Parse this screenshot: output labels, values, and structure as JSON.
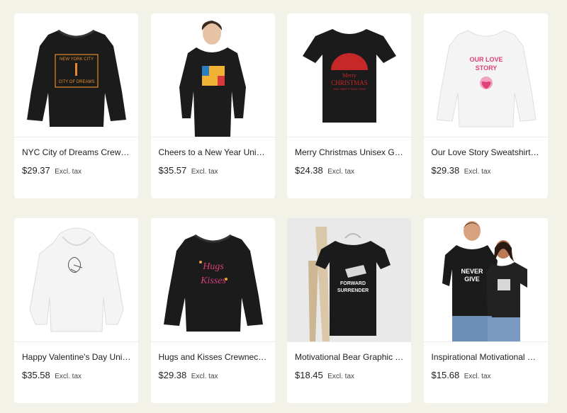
{
  "products": [
    {
      "title": "NYC City of Dreams Crewneck Sweatshirt",
      "price": "$29.37",
      "tax_note": "Excl. tax",
      "image_icon": "black-sweatshirt-nyc-print",
      "banner_top": "NEW YORK CITY",
      "banner_bottom": "CITY OF DREAMS"
    },
    {
      "title": "Cheers to a New Year Unisex Hoodie",
      "price": "$35.57",
      "tax_note": "Excl. tax",
      "image_icon": "woman-black-hoodie-cheers-print"
    },
    {
      "title": "Merry Christmas Unisex Garment-Dyed T-shirt",
      "price": "$24.38",
      "tax_note": "Excl. tax",
      "image_icon": "black-tshirt-christmas-print",
      "print_line1": "Merry",
      "print_line2": "CHRISTMAS",
      "print_line3": "AND HAPPY NEW YEAR"
    },
    {
      "title": "Our Love Story Sweatshirt for Couples",
      "price": "$29.38",
      "tax_note": "Excl. tax",
      "image_icon": "white-sweatshirt-love-story-print",
      "print_line1": "OUR LOVE",
      "print_line2": "STORY"
    },
    {
      "title": "Happy Valentine's Day Unisex Hoodie",
      "price": "$35.58",
      "tax_note": "Excl. tax",
      "image_icon": "white-hoodie-sketch-print"
    },
    {
      "title": "Hugs and Kisses Crewneck Sweatshirt",
      "price": "$29.38",
      "tax_note": "Excl. tax",
      "image_icon": "black-sweatshirt-hugs-kisses-print",
      "print_line1": "Hugs",
      "print_line2": "Kisses"
    },
    {
      "title": "Motivational Bear Graphic Tee",
      "price": "$18.45",
      "tax_note": "Excl. tax",
      "image_icon": "black-tshirt-bear-on-chair",
      "print_line1": "FORWARD",
      "print_line2": "SURRENDER"
    },
    {
      "title": "Inspirational Motivational Shirt",
      "price": "$15.68",
      "tax_note": "Excl. tax",
      "image_icon": "couple-black-tshirts-never-give-up",
      "print_line1": "NEVER",
      "print_line2": "GIVE"
    }
  ],
  "colors": {
    "page_background": "#f3f2e8",
    "card_background": "#ffffff",
    "garment_black": "#1b1b1b",
    "garment_white": "#f4f4f4"
  }
}
